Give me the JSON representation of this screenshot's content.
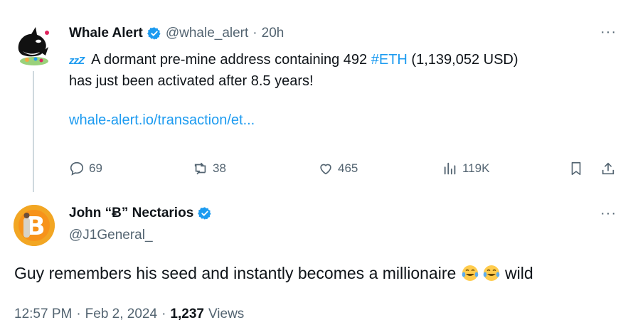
{
  "tweet1": {
    "author_name": "Whale Alert",
    "handle": "@whale_alert",
    "separator": "·",
    "time": "20h",
    "zzz": "zzZ",
    "text_prefix": "A dormant pre-mine address containing 492 ",
    "hashtag": "#ETH",
    "text_suffix": " (1,139,052 USD)",
    "text_line2": "has just been activated after 8.5 years!",
    "link": "whale-alert.io/transaction/et...",
    "stats": {
      "replies": "69",
      "reposts": "38",
      "likes": "465",
      "views": "119K"
    }
  },
  "tweet2": {
    "author_name": "John “Ƀ” Nectarios",
    "handle": "@J1General_",
    "text_before": "Guy remembers his seed and instantly becomes a millionaire ",
    "text_after": " wild",
    "emoji": "face-with-tears-of-joy",
    "time": "12:57 PM",
    "sep1": "·",
    "date": "Feb 2, 2024",
    "sep2": "·",
    "views_count": "1,237",
    "views_label": "Views"
  },
  "colors": {
    "accent": "#1d9bf0",
    "muted": "#536471",
    "text": "#0f1419"
  }
}
